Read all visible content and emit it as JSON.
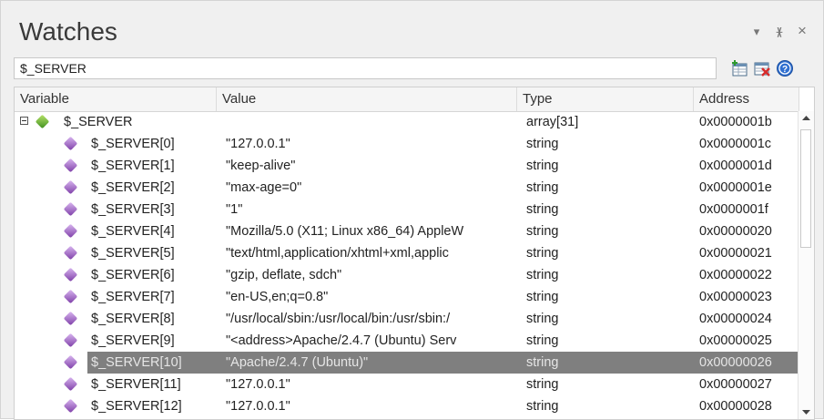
{
  "panel": {
    "title": "Watches",
    "controls": {
      "menu": "▾",
      "pin": "ᚕ",
      "close": "×"
    }
  },
  "expression": {
    "value": "$_SERVER"
  },
  "columns": {
    "variable": "Variable",
    "value": "Value",
    "type": "Type",
    "address": "Address"
  },
  "root": {
    "name": "$_SERVER",
    "value": "",
    "type": "array[31]",
    "address": "0x0000001b"
  },
  "rows": [
    {
      "name": "$_SERVER[0]",
      "value": "\"127.0.0.1\"",
      "type": "string",
      "address": "0x0000001c"
    },
    {
      "name": "$_SERVER[1]",
      "value": "\"keep-alive\"",
      "type": "string",
      "address": "0x0000001d"
    },
    {
      "name": "$_SERVER[2]",
      "value": "\"max-age=0\"",
      "type": "string",
      "address": "0x0000001e"
    },
    {
      "name": "$_SERVER[3]",
      "value": "\"1\"",
      "type": "string",
      "address": "0x0000001f"
    },
    {
      "name": "$_SERVER[4]",
      "value": "\"Mozilla/5.0 (X11; Linux x86_64) AppleW",
      "type": "string",
      "address": "0x00000020"
    },
    {
      "name": "$_SERVER[5]",
      "value": "\"text/html,application/xhtml+xml,applic",
      "type": "string",
      "address": "0x00000021"
    },
    {
      "name": "$_SERVER[6]",
      "value": "\"gzip, deflate, sdch\"",
      "type": "string",
      "address": "0x00000022"
    },
    {
      "name": "$_SERVER[7]",
      "value": "\"en-US,en;q=0.8\"",
      "type": "string",
      "address": "0x00000023"
    },
    {
      "name": "$_SERVER[8]",
      "value": "\"/usr/local/sbin:/usr/local/bin:/usr/sbin:/",
      "type": "string",
      "address": "0x00000024"
    },
    {
      "name": "$_SERVER[9]",
      "value": "\"<address>Apache/2.4.7 (Ubuntu) Serv",
      "type": "string",
      "address": "0x00000025"
    },
    {
      "name": "$_SERVER[10]",
      "value": "\"Apache/2.4.7 (Ubuntu)\"",
      "type": "string",
      "address": "0x00000026",
      "selected": true
    },
    {
      "name": "$_SERVER[11]",
      "value": "\"127.0.0.1\"",
      "type": "string",
      "address": "0x00000027"
    },
    {
      "name": "$_SERVER[12]",
      "value": "\"127.0.0.1\"",
      "type": "string",
      "address": "0x00000028"
    }
  ],
  "icons": {
    "toolbar": [
      "add-watch-icon",
      "delete-watch-icon",
      "help-icon"
    ],
    "root_node": "green-gem-icon",
    "child_node": "purple-gem-icon"
  },
  "colors": {
    "selection": "#7f7f7f",
    "help_blue": "#2f6fd0"
  }
}
